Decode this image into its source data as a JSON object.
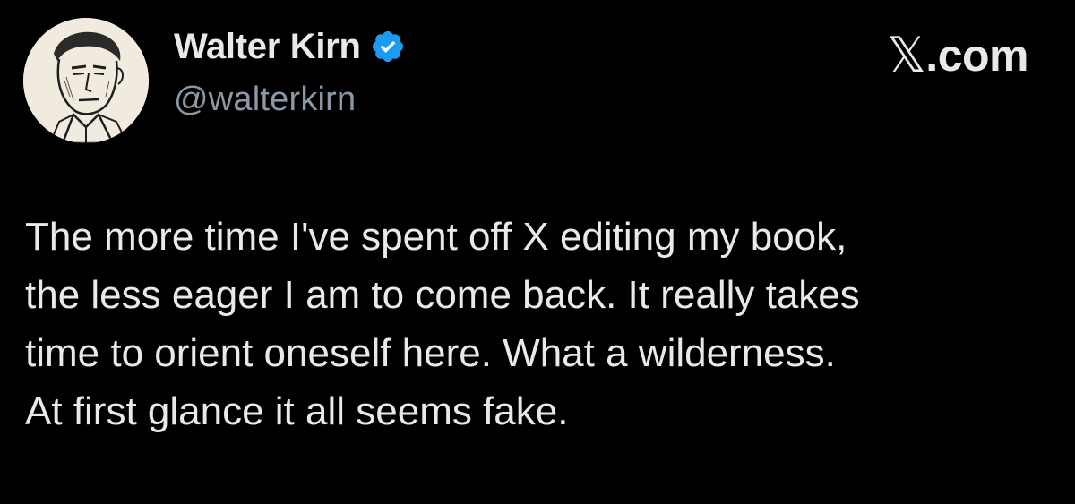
{
  "tweet": {
    "author": {
      "display_name": "Walter Kirn",
      "handle": "@walterkirn",
      "verified": true,
      "verified_icon": "verified-badge-icon",
      "avatar_icon": "portrait-sketch"
    },
    "brand": {
      "mark": "𝕏",
      "domain": ".com"
    },
    "text": "The more time I've spent off X editing my book,\nthe less eager I am to come back. It really takes\ntime to orient oneself here. What a wilderness.\nAt first glance it all seems fake."
  },
  "colors": {
    "background": "#000000",
    "primary_text": "#e7e9ea",
    "secondary_text": "#8b98a5",
    "verified_blue": "#1d9bf0"
  }
}
